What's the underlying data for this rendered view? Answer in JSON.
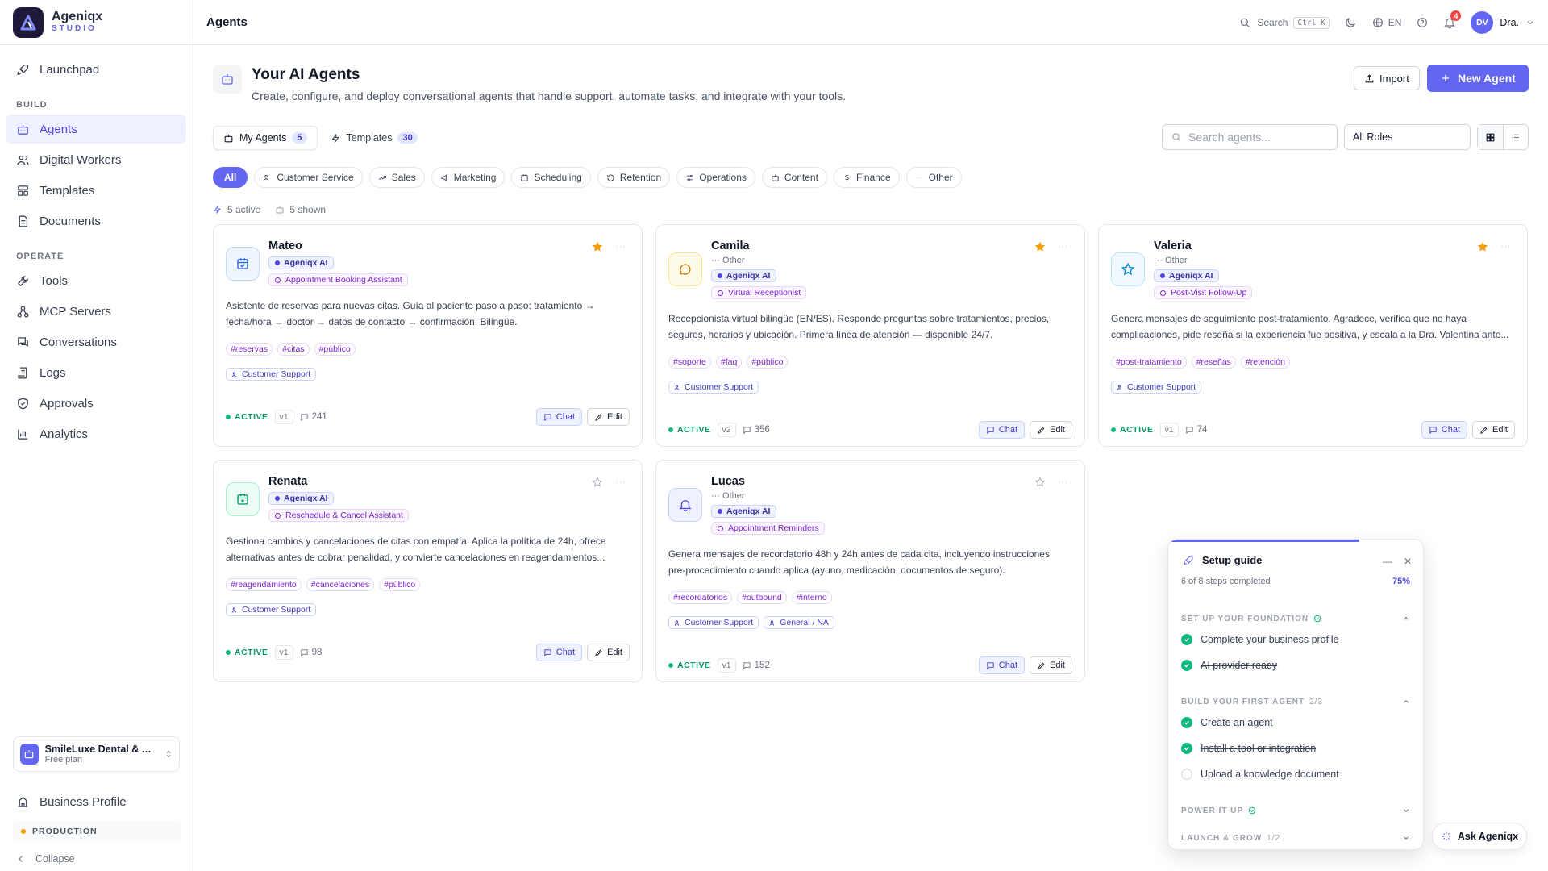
{
  "brand": {
    "name": "Ageniqx",
    "sub": "STUDIO"
  },
  "sidebar": {
    "launchpad": "Launchpad",
    "build_label": "BUILD",
    "build_items": [
      "Agents",
      "Digital Workers",
      "Templates",
      "Documents"
    ],
    "operate_label": "OPERATE",
    "operate_items": [
      "Tools",
      "MCP Servers",
      "Conversations",
      "Logs",
      "Approvals",
      "Analytics"
    ],
    "workspace_name": "SmileLuxe Dental & Ae...",
    "workspace_plan": "Free plan",
    "business_profile": "Business Profile",
    "env": "PRODUCTION",
    "collapse": "Collapse"
  },
  "topbar": {
    "title": "Agents",
    "search": "Search",
    "kbd": "Ctrl K",
    "lang": "EN",
    "notifications": "4",
    "avatar": "DV",
    "user": "Dra."
  },
  "header": {
    "title": "Your AI Agents",
    "subtitle": "Create, configure, and deploy conversational agents that handle support, automate tasks, and integrate with your tools.",
    "import": "Import",
    "new_agent": "New Agent"
  },
  "tabs": [
    {
      "label": "My Agents",
      "count": "5"
    },
    {
      "label": "Templates",
      "count": "30"
    }
  ],
  "search_placeholder": "Search agents...",
  "role_filter": "All Roles",
  "filters": [
    "All",
    "Customer Service",
    "Sales",
    "Marketing",
    "Scheduling",
    "Retention",
    "Operations",
    "Content",
    "Finance",
    "Other"
  ],
  "stats": {
    "active": "5 active",
    "shown": "5 shown"
  },
  "agents": [
    {
      "name": "Mateo",
      "category": "",
      "model": "Ageniqx AI",
      "role": "Appointment Booking Assistant",
      "desc": "Asistente de reservas para nuevas citas. Guía al paciente paso a paso: tratamiento → fecha/hora → doctor → datos de contacto → confirmación. Bilingüe.",
      "tags": [
        "#reservas",
        "#citas",
        "#público"
      ],
      "teams": [
        "Customer Support"
      ],
      "status": "ACTIVE",
      "version": "v1",
      "conversations": "241",
      "starred": true,
      "icon": "calendar-icon",
      "chat": "Chat",
      "edit": "Edit"
    },
    {
      "name": "Camila",
      "category": "Other",
      "model": "Ageniqx AI",
      "role": "Virtual Receptionist",
      "desc": "Recepcionista virtual bilingüe (EN/ES). Responde preguntas sobre tratamientos, precios, seguros, horarios y ubicación. Primera línea de atención — disponible 24/7.",
      "tags": [
        "#soporte",
        "#faq",
        "#público"
      ],
      "teams": [
        "Customer Support"
      ],
      "status": "ACTIVE",
      "version": "v2",
      "conversations": "356",
      "starred": true,
      "icon": "chat-bubble-icon",
      "chat": "Chat",
      "edit": "Edit"
    },
    {
      "name": "Valeria",
      "category": "Other",
      "model": "Ageniqx AI",
      "role": "Post-Visit Follow-Up",
      "desc": "Genera mensajes de seguimiento post-tratamiento. Agradece, verifica que no haya complicaciones, pide reseña si la experiencia fue positiva, y escala a la Dra. Valentina ante...",
      "tags": [
        "#post-tratamiento",
        "#reseñas",
        "#retención"
      ],
      "teams": [
        "Customer Support"
      ],
      "status": "ACTIVE",
      "version": "v1",
      "conversations": "74",
      "starred": true,
      "icon": "star-icon",
      "chat": "Chat",
      "edit": "Edit"
    },
    {
      "name": "Renata",
      "category": "",
      "model": "Ageniqx AI",
      "role": "Reschedule & Cancel Assistant",
      "desc": "Gestiona cambios y cancelaciones de citas con empatía. Aplica la política de 24h, ofrece alternativas antes de cobrar penalidad, y convierte cancelaciones en reagendamientos...",
      "tags": [
        "#reagendamiento",
        "#cancelaciones",
        "#público"
      ],
      "teams": [
        "Customer Support"
      ],
      "status": "ACTIVE",
      "version": "v1",
      "conversations": "98",
      "starred": false,
      "icon": "calendar-x-icon",
      "chat": "Chat",
      "edit": "Edit"
    },
    {
      "name": "Lucas",
      "category": "Other",
      "model": "Ageniqx AI",
      "role": "Appointment Reminders",
      "desc": "Genera mensajes de recordatorio 48h y 24h antes de cada cita, incluyendo instrucciones pre-procedimiento cuando aplica (ayuno, medicación, documentos de seguro).",
      "tags": [
        "#recordatorios",
        "#outbound",
        "#interno"
      ],
      "teams": [
        "Customer Support",
        "General / NA"
      ],
      "status": "ACTIVE",
      "version": "v1",
      "conversations": "152",
      "starred": false,
      "icon": "bell-icon",
      "chat": "Chat",
      "edit": "Edit"
    }
  ],
  "guide": {
    "title": "Setup guide",
    "steps": "6 of 8 steps completed",
    "percent": "75%",
    "progress": 0.75,
    "sections": [
      {
        "label": "SET UP YOUR FOUNDATION",
        "count": ""
      },
      {
        "label": "BUILD YOUR FIRST AGENT",
        "count": "2/3"
      },
      {
        "label": "POWER IT UP",
        "count": ""
      },
      {
        "label": "LAUNCH & GROW",
        "count": "1/2"
      }
    ],
    "items": [
      {
        "label": "Complete your business profile",
        "done": true
      },
      {
        "label": "AI provider ready",
        "done": true
      },
      {
        "label": "Create an agent",
        "done": true
      },
      {
        "label": "Install a tool or integration",
        "done": true
      },
      {
        "label": "Upload a knowledge document",
        "done": false
      }
    ]
  },
  "ask": "Ask Ageniqx",
  "colors": {
    "accent": "#6366f1",
    "active": "#10b981",
    "star": "#f59e0b"
  }
}
